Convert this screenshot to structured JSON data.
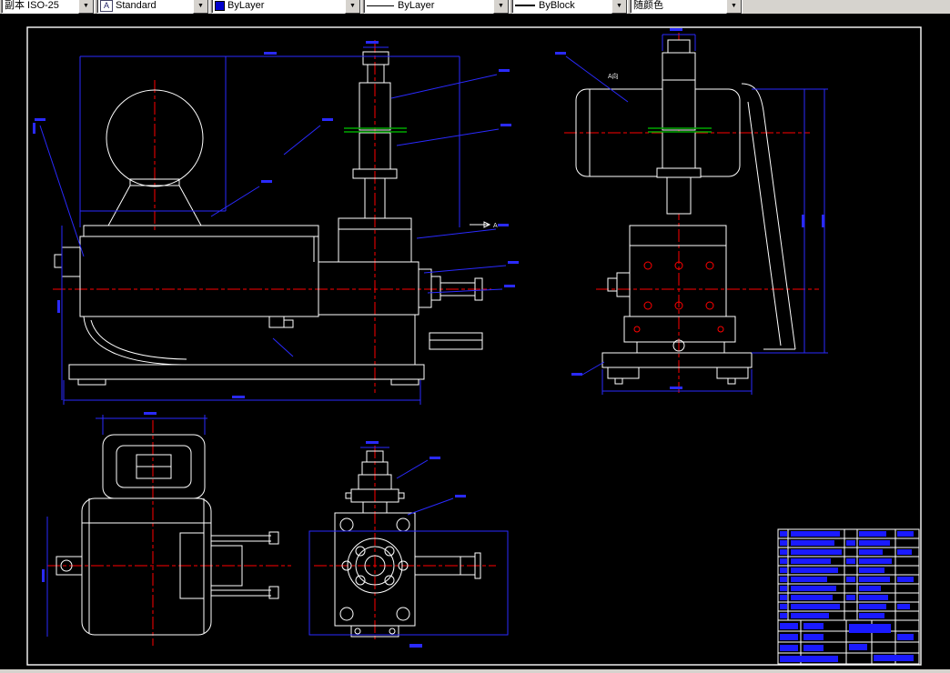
{
  "toolbar": {
    "dim_style": {
      "value": "副本 ISO-25"
    },
    "text_style": {
      "value": "Standard",
      "icon_glyph": "A"
    },
    "color": {
      "value": "ByLayer",
      "swatch_color": "#0000cc"
    },
    "linetype": {
      "value": "ByLayer"
    },
    "lineweight": {
      "value": "ByBlock"
    },
    "plot_style": {
      "value": "随颜色"
    },
    "arrow_glyph": "▼"
  },
  "drawing": {
    "labels": {
      "view_direction": "A向",
      "section_mark": "A"
    },
    "colors": {
      "geometry": "#ffffff",
      "dimension": "#2a2aff",
      "centerline": "#ff0000",
      "section_line": "#00a800",
      "title_block_text": "#1a1aff",
      "sheet_frame": "#ffffff",
      "background": "#000000"
    }
  }
}
